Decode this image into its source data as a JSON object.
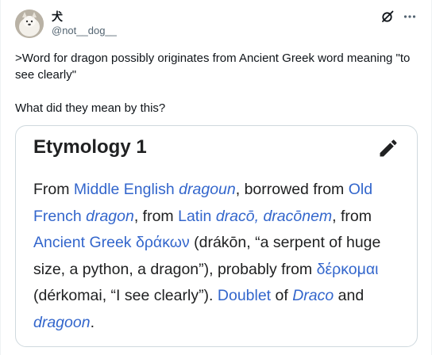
{
  "author": {
    "display_name": "犬",
    "handle": "@not__dog__"
  },
  "header_actions": {
    "grok_icon": "grok-icon",
    "more_icon": "more-icon"
  },
  "tweet": {
    "line1": ">Word for dragon possibly originates from Ancient Greek word meaning \"to see clearly\"",
    "line2": "What did they mean by this?"
  },
  "image": {
    "title": "Etymology 1",
    "edit_icon": "pencil-icon",
    "text": {
      "p1": "From ",
      "l1": "Middle English",
      "p2": " ",
      "l2": "dragoun",
      "p3": ", borrowed from ",
      "l3": "Old French",
      "p4": " ",
      "l4": "dragon",
      "p5": ", from ",
      "l5": "Latin",
      "p6": " ",
      "l6": "dracō, dracōnem",
      "p7": ", from ",
      "l7": "Ancient Greek",
      "p8": " ",
      "l8": "δράκων",
      "p9": " (drákōn, “a serpent of huge size, a python, a dragon”), probably from ",
      "l9": "δέρκομαι",
      "p10": " (dérkomai, “I see clearly”). ",
      "l10": "Doublet",
      "p11": " of ",
      "l11": "Draco",
      "p12": " and ",
      "l12": "dragoon",
      "p13": "."
    }
  },
  "colors": {
    "link": "#3366cc",
    "text": "#202122",
    "border": "#cfd9de"
  }
}
